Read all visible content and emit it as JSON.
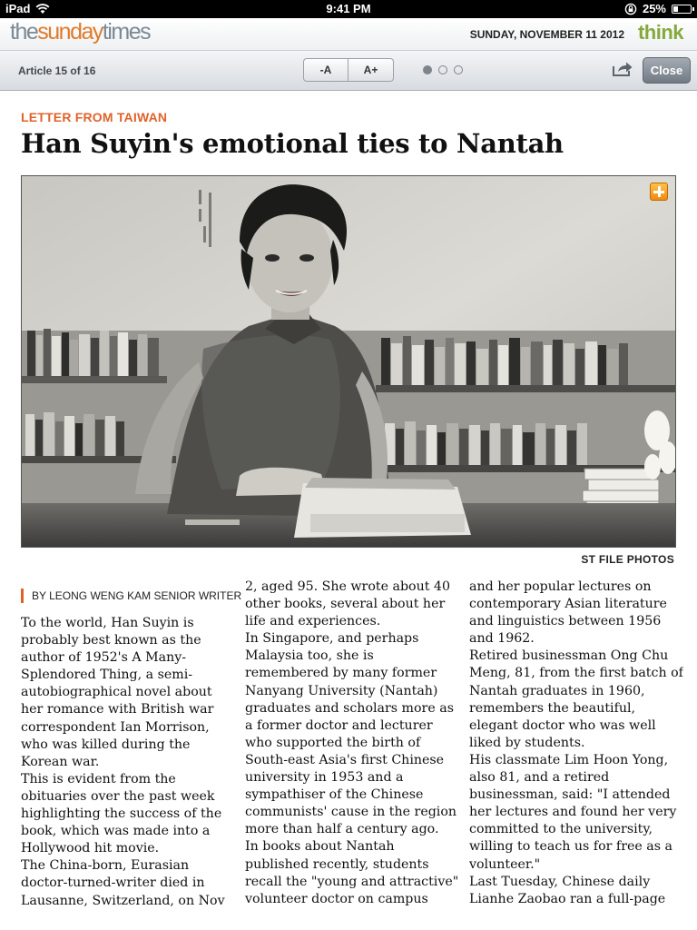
{
  "status_bar": {
    "device": "iPad",
    "time": "9:41 PM",
    "battery": "25%",
    "battery_level": 0.25
  },
  "masthead": {
    "logo_the": "the",
    "logo_sunday": "sunday",
    "logo_times": "times",
    "date": "SUNDAY, NOVEMBER 11 2012",
    "section_brand": "think",
    "colors": {
      "logo_grey": "#7a8a96",
      "logo_orange": "#e07a2a",
      "think_green": "#86a93c"
    }
  },
  "toolbar": {
    "article_counter": "Article 15 of 16",
    "font_decrease": "-A",
    "font_increase": "A+",
    "pages": [
      {
        "active": true
      },
      {
        "active": false
      },
      {
        "active": false
      }
    ],
    "close": "Close"
  },
  "article": {
    "kicker": "LETTER FROM TAIWAN",
    "headline": "Han Suyin's emotional ties to Nantah",
    "photo_credit": "ST FILE PHOTOS",
    "byline": "BY LEONG WENG KAM SENIOR WRITER",
    "accent_color": "#e0622a",
    "columns": [
      [
        "To the world, Han Suyin is",
        "probably best known as the",
        "author of 1952's A Many-",
        "Splendored Thing, a semi-",
        "autobiographical novel about",
        "her romance with British war",
        "correspondent Ian Morrison,",
        "who was killed during the",
        "Korean war.",
        " This is evident from the",
        "obituaries over the past week",
        "highlighting the success of the",
        "book, which was made into a",
        "Hollywood hit movie.",
        " The China-born, Eurasian",
        "doctor-turned-writer died in",
        "Lausanne, Switzerland, on Nov"
      ],
      [
        "2, aged 95. She wrote about 40",
        "other books, several about her",
        "life and experiences.",
        " In Singapore, and perhaps",
        "Malaysia too, she is",
        "remembered by many former",
        "Nanyang University (Nantah)",
        "graduates and scholars more as",
        "a former doctor and lecturer",
        "who supported the birth of",
        "South-east Asia's first Chinese",
        "university in 1953 and a",
        "sympathiser of the Chinese",
        "communists' cause in the region",
        "more than half a century ago.",
        " In books about Nantah",
        "published recently, students",
        "recall the \"young and attractive\"",
        "volunteer doctor on campus"
      ],
      [
        "and her popular lectures on",
        "contemporary Asian literature",
        "and linguistics between 1956",
        "and 1962.",
        " Retired businessman Ong Chu",
        "Meng, 81, from the first batch of",
        "Nantah graduates in 1960,",
        "remembers the beautiful,",
        "elegant doctor who was well",
        "liked by students.",
        " His classmate Lim Hoon Yong,",
        "also 81, and a retired",
        "businessman, said: \"I attended",
        "her lectures and found her very",
        "committed to the university,",
        "willing to teach us for free as a",
        "volunteer.\"",
        " Last Tuesday, Chinese daily",
        "Lianhe Zaobao ran a full-page"
      ]
    ]
  }
}
